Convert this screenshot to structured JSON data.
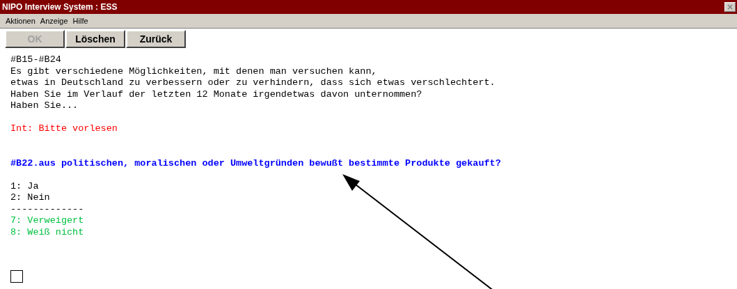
{
  "window": {
    "title": "NIPO Interview System : ESS",
    "close": "×"
  },
  "menu": [
    "Aktionen",
    "Anzeige",
    "Hilfe"
  ],
  "buttons": [
    {
      "label": "OK",
      "disabled": true
    },
    {
      "label": "Löschen",
      "disabled": false
    },
    {
      "label": "Zurück",
      "disabled": false
    }
  ],
  "blocks": [
    {
      "kind": "text",
      "lines": [
        "#B15-#B24",
        "Es gibt verschiedene Möglichkeiten, mit denen man versuchen kann,",
        "etwas in Deutschland zu verbessern oder zu verhindern, dass sich etwas verschlechtert.",
        "Haben Sie im Verlauf der letzten 12 Monate irgendetwas davon unternommen?",
        "Haben Sie..."
      ]
    },
    {
      "kind": "instruction",
      "lines": [
        "Int: Bitte vorlesen"
      ]
    },
    {
      "kind": "question",
      "lines": [
        "#B22.aus politischen, moralischen oder Umweltgründen bewußt bestimmte Produkte gekauft?"
      ]
    },
    {
      "kind": "answers",
      "lines": [
        "1: Ja",
        "2: Nein",
        "-------------"
      ]
    },
    {
      "kind": "code",
      "lines": [
        "7: Verweigert",
        "8: Weiß nicht"
      ]
    }
  ],
  "answer": {
    "checked": false
  }
}
